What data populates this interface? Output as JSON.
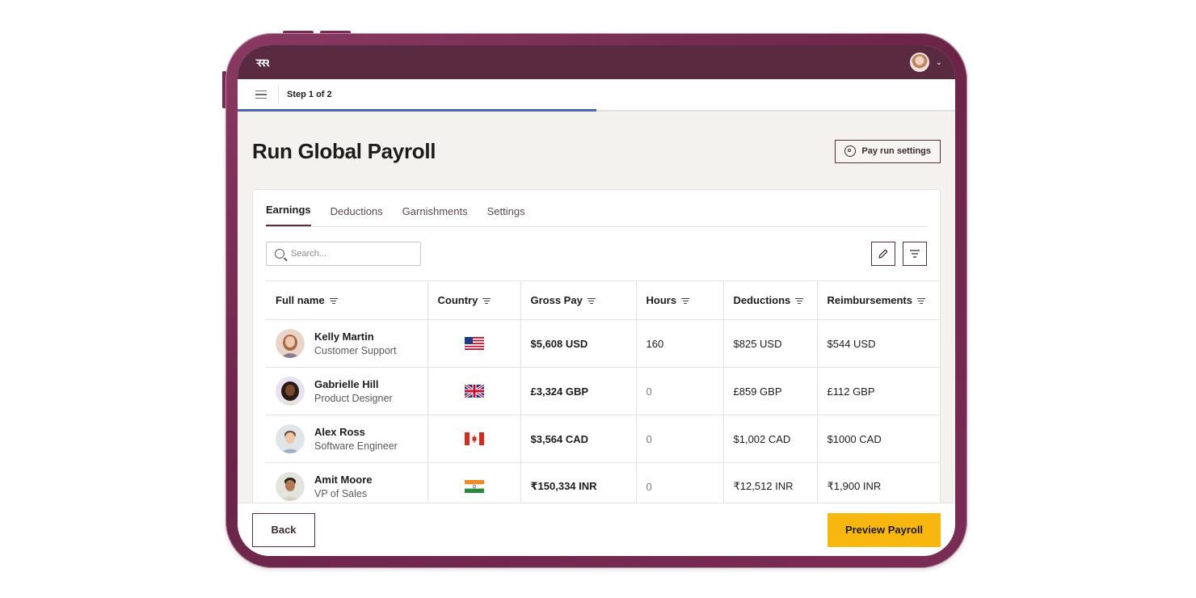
{
  "app": {
    "logo_text": "ꝛꝛꝛ",
    "step": "Step 1 of 2",
    "progress_fraction": 0.5
  },
  "page": {
    "title": "Run Global Payroll",
    "settings_button": "Pay run settings"
  },
  "tabs": [
    {
      "label": "Earnings",
      "active": true
    },
    {
      "label": "Deductions",
      "active": false
    },
    {
      "label": "Garnishments",
      "active": false
    },
    {
      "label": "Settings",
      "active": false
    }
  ],
  "search": {
    "placeholder": "Search..."
  },
  "table": {
    "columns": [
      "Full name",
      "Country",
      "Gross Pay",
      "Hours",
      "Deductions",
      "Reimbursements"
    ],
    "rows": [
      {
        "name": "Kelly Martin",
        "role": "Customer Support",
        "flag": "us-flag-icon",
        "gross": "$5,608 USD",
        "hours": "160",
        "deductions": "$825 USD",
        "reimbursements": "$544 USD"
      },
      {
        "name": "Gabrielle Hill",
        "role": "Product Designer",
        "flag": "uk-flag-icon",
        "gross": "£3,324 GBP",
        "hours": "0",
        "deductions": "£859 GBP",
        "reimbursements": "£112 GBP"
      },
      {
        "name": "Alex Ross",
        "role": "Software Engineer",
        "flag": "canada-flag-icon",
        "gross": "$3,564 CAD",
        "hours": "0",
        "deductions": "$1,002 CAD",
        "reimbursements": "$1000 CAD"
      },
      {
        "name": "Amit Moore",
        "role": "VP of Sales",
        "flag": "india-flag-icon",
        "gross": "₹150,334 INR",
        "hours": "0",
        "deductions": "₹12,512 INR",
        "reimbursements": "₹1,900 INR"
      }
    ]
  },
  "footer": {
    "back": "Back",
    "preview": "Preview Payroll"
  },
  "colors": {
    "frame": "#6b2447",
    "header": "#5a2a41",
    "accent_progress": "#4a64b0",
    "primary_button": "#f8b70e"
  }
}
